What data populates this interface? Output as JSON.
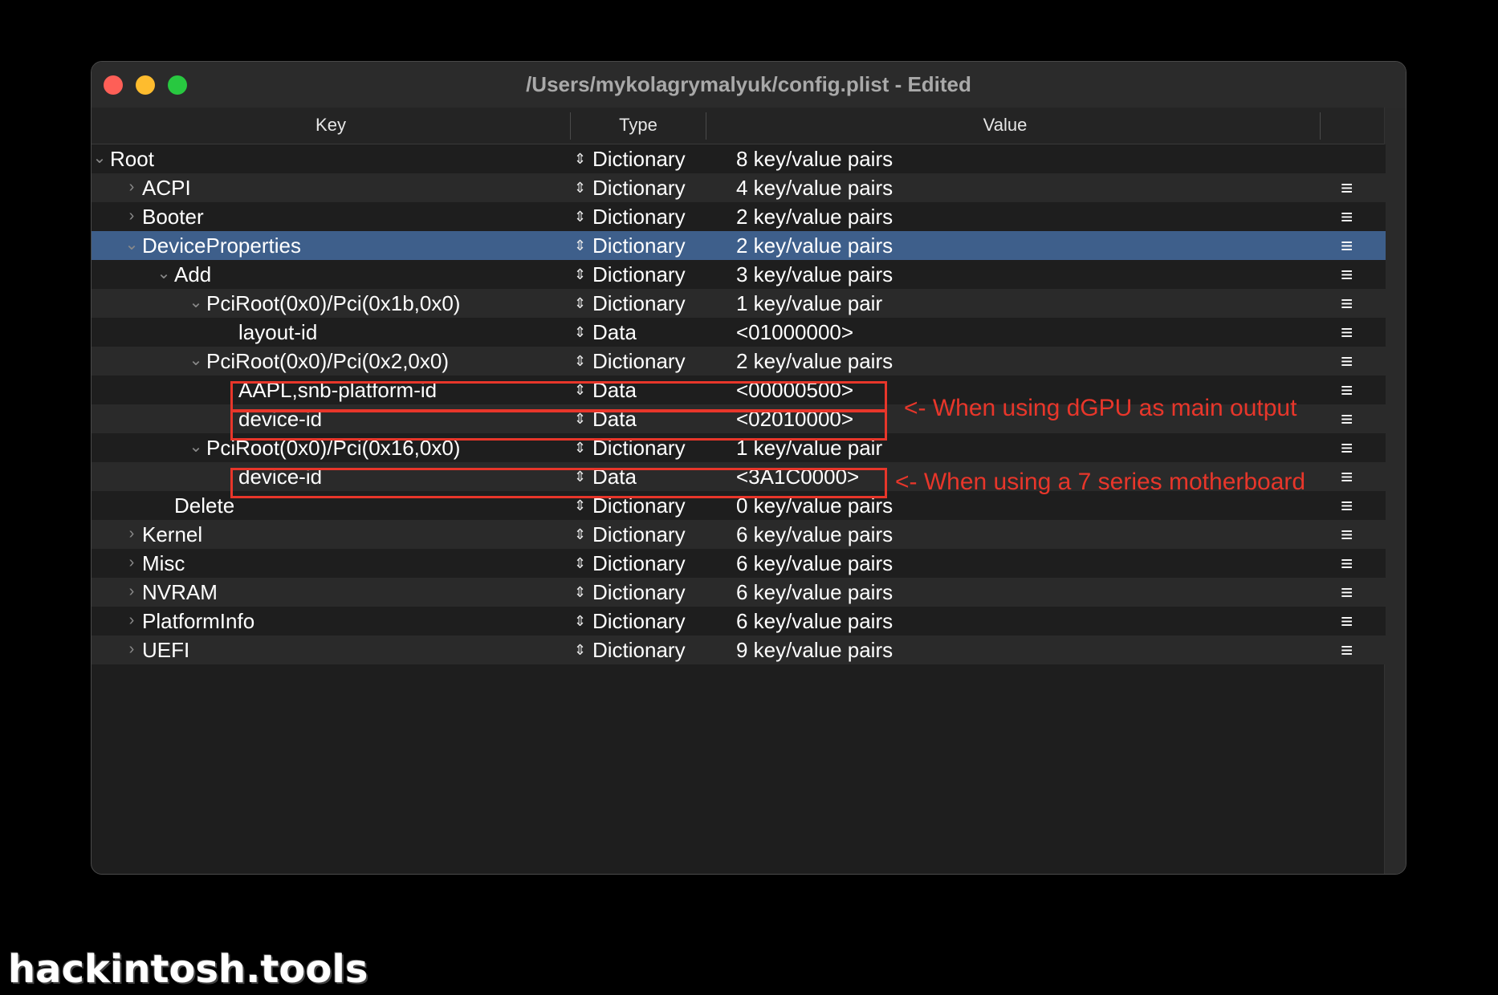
{
  "window": {
    "title": "/Users/mykolagrymalyuk/config.plist - Edited"
  },
  "columns": {
    "key": "Key",
    "type": "Type",
    "value": "Value"
  },
  "stepper_glyph": "⇕",
  "menu_glyph": "≡",
  "rows": [
    {
      "key": "Root",
      "type": "Dictionary",
      "value": "8 key/value pairs",
      "depth": 0,
      "disclosure": "expanded",
      "menu": false
    },
    {
      "key": "ACPI",
      "type": "Dictionary",
      "value": "4 key/value pairs",
      "depth": 1,
      "disclosure": "collapsed",
      "menu": true
    },
    {
      "key": "Booter",
      "type": "Dictionary",
      "value": "2 key/value pairs",
      "depth": 1,
      "disclosure": "collapsed",
      "menu": true
    },
    {
      "key": "DeviceProperties",
      "type": "Dictionary",
      "value": "2 key/value pairs",
      "depth": 1,
      "disclosure": "expanded",
      "menu": true,
      "selected": true
    },
    {
      "key": "Add",
      "type": "Dictionary",
      "value": "3 key/value pairs",
      "depth": 2,
      "disclosure": "expanded",
      "menu": true
    },
    {
      "key": "PciRoot(0x0)/Pci(0x1b,0x0)",
      "type": "Dictionary",
      "value": "1 key/value pair",
      "depth": 3,
      "disclosure": "expanded",
      "menu": true
    },
    {
      "key": "layout-id",
      "type": "Data",
      "value": "<01000000>",
      "depth": 4,
      "disclosure": "none",
      "menu": true
    },
    {
      "key": "PciRoot(0x0)/Pci(0x2,0x0)",
      "type": "Dictionary",
      "value": "2 key/value pairs",
      "depth": 3,
      "disclosure": "expanded",
      "menu": true
    },
    {
      "key": "AAPL,snb-platform-id",
      "type": "Data",
      "value": "<00000500>",
      "depth": 4,
      "disclosure": "none",
      "menu": true
    },
    {
      "key": "device-id",
      "type": "Data",
      "value": "<02010000>",
      "depth": 4,
      "disclosure": "none",
      "menu": true
    },
    {
      "key": "PciRoot(0x0)/Pci(0x16,0x0)",
      "type": "Dictionary",
      "value": "1 key/value pair",
      "depth": 3,
      "disclosure": "expanded",
      "menu": true
    },
    {
      "key": "device-id",
      "type": "Data",
      "value": "<3A1C0000>",
      "depth": 4,
      "disclosure": "none",
      "menu": true
    },
    {
      "key": "Delete",
      "type": "Dictionary",
      "value": "0 key/value pairs",
      "depth": 2,
      "disclosure": "none",
      "menu": true
    },
    {
      "key": "Kernel",
      "type": "Dictionary",
      "value": "6 key/value pairs",
      "depth": 1,
      "disclosure": "collapsed",
      "menu": true
    },
    {
      "key": "Misc",
      "type": "Dictionary",
      "value": "6 key/value pairs",
      "depth": 1,
      "disclosure": "collapsed",
      "menu": true
    },
    {
      "key": "NVRAM",
      "type": "Dictionary",
      "value": "6 key/value pairs",
      "depth": 1,
      "disclosure": "collapsed",
      "menu": true
    },
    {
      "key": "PlatformInfo",
      "type": "Dictionary",
      "value": "6 key/value pairs",
      "depth": 1,
      "disclosure": "collapsed",
      "menu": true
    },
    {
      "key": "UEFI",
      "type": "Dictionary",
      "value": "9 key/value pairs",
      "depth": 1,
      "disclosure": "collapsed",
      "menu": true
    }
  ],
  "annotations": {
    "dgpu": "<- When using dGPU as main output",
    "series7": "<- When using a 7 series motherboard"
  },
  "watermark": "hackintosh.tools",
  "colors": {
    "selection": "#3e5f8b",
    "annotation": "#e8362a",
    "close": "#fe5f57",
    "minimize": "#febc2e",
    "zoom": "#28c840"
  }
}
